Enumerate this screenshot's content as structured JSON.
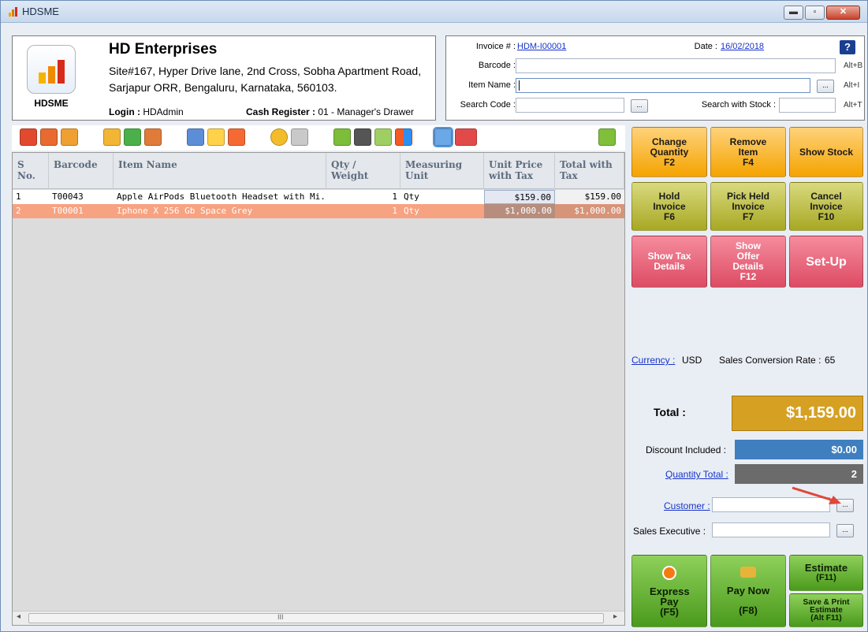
{
  "window": {
    "title": "HDSME",
    "minimize": "▬",
    "maximize": "▫",
    "close": "✕"
  },
  "company": {
    "logo_text": "HDSME",
    "name": "HD Enterprises",
    "address": "Site#167, Hyper Drive lane, 2nd Cross, Sobha Apartment Road, Sarjapur ORR, Bengaluru, Karnataka, 560103.",
    "login_label": "Login :",
    "login_value": "HDAdmin",
    "cash_register_label": "Cash Register :",
    "cash_register_value": "01 - Manager's Drawer"
  },
  "invoice": {
    "invoice_label": "Invoice # :",
    "invoice_number": "HDM-I00001",
    "date_label": "Date :",
    "date_value": "16/02/2018",
    "help": "?",
    "barcode_label": "Barcode :",
    "barcode_hint": "Alt+B",
    "item_name_label": "Item Name :",
    "item_name_hint": "Alt+I",
    "search_code_label": "Search Code :",
    "search_stock_label": "Search with Stock :",
    "search_stock_hint": "Alt+T",
    "browse": "..."
  },
  "grid": {
    "columns": [
      "S No.",
      "Barcode",
      "Item Name",
      "Qty / Weight",
      "Measuring Unit",
      "Unit Price with Tax",
      "Total with Tax"
    ],
    "rows": [
      {
        "sno": "1",
        "barcode": "T00043",
        "item": "Apple AirPods Bluetooth Headset with Mi...",
        "qty": "1",
        "unit": "Qty",
        "price": "$159.00",
        "total": "$159.00"
      },
      {
        "sno": "2",
        "barcode": "T00001",
        "item": "Iphone X 256 Gb Space Grey",
        "qty": "1",
        "unit": "Qty",
        "price": "$1,000.00",
        "total": "$1,000.00"
      }
    ],
    "scroll_left": "◂",
    "scroll_right": "▸",
    "scroll_mid": "III"
  },
  "actions": {
    "change_quantity": "Change Quantity",
    "change_quantity_key": "F2",
    "remove_item": "Remove Item",
    "remove_item_key": "F4",
    "show_stock": "Show Stock",
    "hold_invoice": "Hold Invoice",
    "hold_invoice_key": "F6",
    "pick_held": "Pick Held Invoice",
    "pick_held_key": "F7",
    "cancel_invoice": "Cancel Invoice",
    "cancel_invoice_key": "F10",
    "show_tax": "Show Tax Details",
    "show_offer": "Show Offer Details",
    "show_offer_key": "F12",
    "setup": "Set-Up",
    "express_pay": "Express Pay",
    "express_pay_key": "(F5)",
    "pay_now": "Pay Now",
    "pay_now_key": "(F8)",
    "estimate": "Estimate",
    "estimate_key": "(F11)",
    "save_print": "Save & Print Estimate",
    "save_print_key": "(Alt F11)"
  },
  "summary": {
    "currency_label": "Currency :",
    "currency_value": "USD",
    "conversion_label": "Sales Conversion Rate :",
    "conversion_value": "65",
    "total_label": "Total :",
    "total_value": "$1,159.00",
    "discount_label": "Discount Included :",
    "discount_value": "$0.00",
    "quantity_label": "Quantity Total :",
    "quantity_value": "2",
    "customer_label": "Customer :",
    "sales_exec_label": "Sales Executive :"
  },
  "colors": {
    "selected_row": "#f7a280",
    "total_box": "#d6a023",
    "discount_box": "#3f7fbf",
    "quantity_box": "#6b6b6b",
    "arrow": "#e0473a"
  }
}
